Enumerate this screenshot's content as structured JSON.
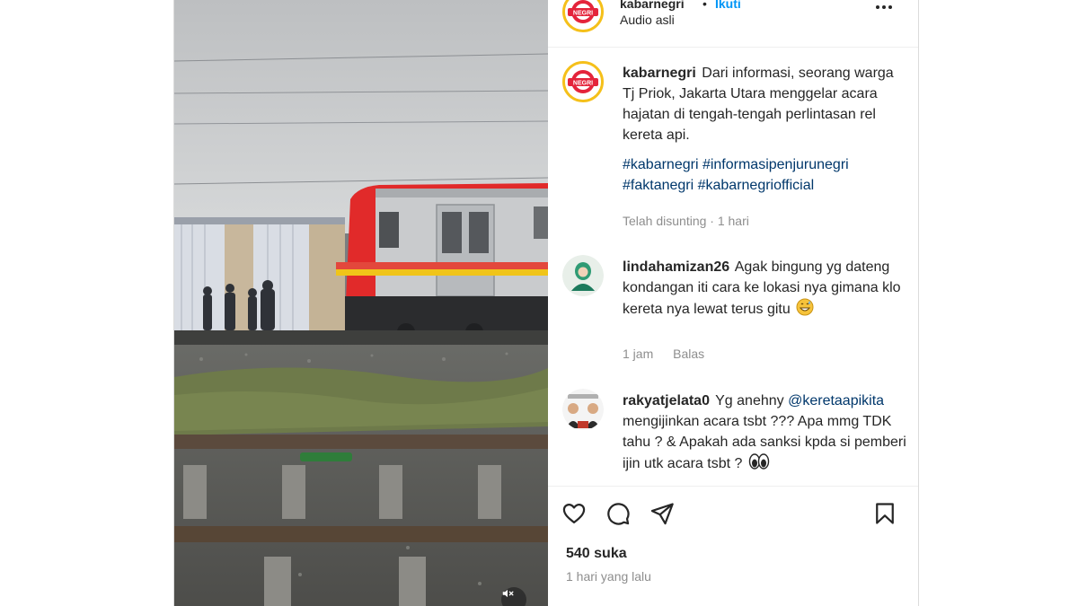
{
  "post": {
    "username": "kabarnegri",
    "follow_label": "Ikuti",
    "audio_label": "Audio asli",
    "avatar_logo_text": "NEGRI"
  },
  "caption": {
    "username": "kabarnegri",
    "text": "Dari informasi, seorang warga Tj Priok, Jakarta Utara menggelar acara hajatan di tengah-tengah perlintasan rel kereta api.",
    "hashtags": "#kabarnegri #informasipenjurunegri #faktanegri #kabarnegriofficial",
    "meta": "Telah disunting · 1 hari"
  },
  "comments": [
    {
      "username": "lindahamizan26",
      "text": "Agak bingung yg dateng kondangan iti cara ke lokasi nya gimana klo kereta nya lewat terus gitu",
      "emoji": "grinning-sweat-emoji",
      "time": "1 jam",
      "reply_label": "Balas"
    },
    {
      "username": "rakyatjelata0",
      "text_before": "Yg anehny",
      "mention": "@keretaapikita",
      "text_after": "mengijinkan acara tsbt ??? Apa mmg TDK tahu ? & Apakah ada sanksi kpda si pemberi ijin utk acara tsbt ?",
      "emoji": "eyes-emoji"
    }
  ],
  "actions": {
    "likes": "540 suka",
    "posted": "1 hari yang lalu",
    "icons": [
      "heart-icon",
      "comment-icon",
      "share-icon",
      "bookmark-icon"
    ]
  },
  "media": {
    "muted_icon": "speaker-muted-icon"
  },
  "colors": {
    "link": "#00376b",
    "follow": "#0095f6",
    "muted_text": "#8e8e8e",
    "brand_ring": "#f5c01a",
    "brand_red": "#e4243b"
  }
}
